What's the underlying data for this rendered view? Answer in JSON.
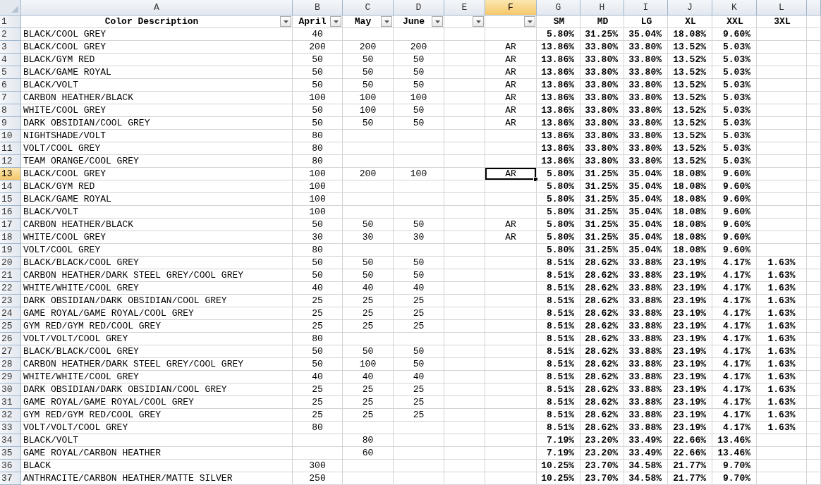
{
  "columns": [
    {
      "letter": "A",
      "selected": false
    },
    {
      "letter": "B",
      "selected": false
    },
    {
      "letter": "C",
      "selected": false
    },
    {
      "letter": "D",
      "selected": false
    },
    {
      "letter": "E",
      "selected": false
    },
    {
      "letter": "F",
      "selected": true
    },
    {
      "letter": "G",
      "selected": false
    },
    {
      "letter": "H",
      "selected": false
    },
    {
      "letter": "I",
      "selected": false
    },
    {
      "letter": "J",
      "selected": false
    },
    {
      "letter": "K",
      "selected": false
    },
    {
      "letter": "L",
      "selected": false
    }
  ],
  "header_row": {
    "number": "1",
    "selected": false,
    "cells": [
      {
        "text": "Color Description",
        "filter": true
      },
      {
        "text": "April",
        "filter": true
      },
      {
        "text": "May",
        "filter": true
      },
      {
        "text": "June",
        "filter": true
      },
      {
        "filter": true
      },
      {
        "filter": true
      },
      {
        "text": "SM",
        "filter": false
      },
      {
        "text": "MD",
        "filter": false
      },
      {
        "text": "LG",
        "filter": false
      },
      {
        "text": "XL",
        "filter": false
      },
      {
        "text": "XXL",
        "filter": false
      },
      {
        "text": "3XL",
        "filter": false
      }
    ]
  },
  "rows": [
    {
      "number": "2",
      "selected": false,
      "cells": {
        "A": "BLACK/COOL GREY",
        "B": "40",
        "G": "5.80%",
        "H": "31.25%",
        "I": "35.04%",
        "J": "18.08%",
        "K": "9.60%"
      }
    },
    {
      "number": "3",
      "selected": false,
      "cells": {
        "A": "BLACK/COOL GREY",
        "B": "200",
        "C": "200",
        "D": "200",
        "F": "AR",
        "G": "13.86%",
        "H": "33.80%",
        "I": "33.80%",
        "J": "13.52%",
        "K": "5.03%"
      }
    },
    {
      "number": "4",
      "selected": false,
      "cells": {
        "A": "BLACK/GYM RED",
        "B": "50",
        "C": "50",
        "D": "50",
        "F": "AR",
        "G": "13.86%",
        "H": "33.80%",
        "I": "33.80%",
        "J": "13.52%",
        "K": "5.03%"
      }
    },
    {
      "number": "5",
      "selected": false,
      "cells": {
        "A": "BLACK/GAME ROYAL",
        "B": "50",
        "C": "50",
        "D": "50",
        "F": "AR",
        "G": "13.86%",
        "H": "33.80%",
        "I": "33.80%",
        "J": "13.52%",
        "K": "5.03%"
      }
    },
    {
      "number": "6",
      "selected": false,
      "cells": {
        "A": "BLACK/VOLT",
        "B": "50",
        "C": "50",
        "D": "50",
        "F": "AR",
        "G": "13.86%",
        "H": "33.80%",
        "I": "33.80%",
        "J": "13.52%",
        "K": "5.03%"
      }
    },
    {
      "number": "7",
      "selected": false,
      "cells": {
        "A": "CARBON HEATHER/BLACK",
        "B": "100",
        "C": "100",
        "D": "100",
        "F": "AR",
        "G": "13.86%",
        "H": "33.80%",
        "I": "33.80%",
        "J": "13.52%",
        "K": "5.03%"
      }
    },
    {
      "number": "8",
      "selected": false,
      "cells": {
        "A": "WHITE/COOL GREY",
        "B": "50",
        "C": "100",
        "D": "50",
        "F": "AR",
        "G": "13.86%",
        "H": "33.80%",
        "I": "33.80%",
        "J": "13.52%",
        "K": "5.03%"
      }
    },
    {
      "number": "9",
      "selected": false,
      "cells": {
        "A": "DARK OBSIDIAN/COOL GREY",
        "B": "50",
        "C": "50",
        "D": "50",
        "F": "AR",
        "G": "13.86%",
        "H": "33.80%",
        "I": "33.80%",
        "J": "13.52%",
        "K": "5.03%"
      }
    },
    {
      "number": "10",
      "selected": false,
      "cells": {
        "A": "NIGHTSHADE/VOLT",
        "B": "80",
        "G": "13.86%",
        "H": "33.80%",
        "I": "33.80%",
        "J": "13.52%",
        "K": "5.03%"
      }
    },
    {
      "number": "11",
      "selected": false,
      "cells": {
        "A": "VOLT/COOL GREY",
        "B": "80",
        "G": "13.86%",
        "H": "33.80%",
        "I": "33.80%",
        "J": "13.52%",
        "K": "5.03%"
      }
    },
    {
      "number": "12",
      "selected": false,
      "cells": {
        "A": "TEAM ORANGE/COOL GREY",
        "B": "80",
        "G": "13.86%",
        "H": "33.80%",
        "I": "33.80%",
        "J": "13.52%",
        "K": "5.03%"
      }
    },
    {
      "number": "13",
      "selected": true,
      "cells": {
        "A": "BLACK/COOL GREY",
        "B": "100",
        "C": "200",
        "D": "100",
        "F": "AR",
        "G": "5.80%",
        "H": "31.25%",
        "I": "35.04%",
        "J": "18.08%",
        "K": "9.60%"
      }
    },
    {
      "number": "14",
      "selected": false,
      "cells": {
        "A": "BLACK/GYM RED",
        "B": "100",
        "G": "5.80%",
        "H": "31.25%",
        "I": "35.04%",
        "J": "18.08%",
        "K": "9.60%"
      }
    },
    {
      "number": "15",
      "selected": false,
      "cells": {
        "A": "BLACK/GAME ROYAL",
        "B": "100",
        "G": "5.80%",
        "H": "31.25%",
        "I": "35.04%",
        "J": "18.08%",
        "K": "9.60%"
      }
    },
    {
      "number": "16",
      "selected": false,
      "cells": {
        "A": "BLACK/VOLT",
        "B": "100",
        "G": "5.80%",
        "H": "31.25%",
        "I": "35.04%",
        "J": "18.08%",
        "K": "9.60%"
      }
    },
    {
      "number": "17",
      "selected": false,
      "cells": {
        "A": "CARBON HEATHER/BLACK",
        "B": "50",
        "C": "50",
        "D": "50",
        "F": "AR",
        "G": "5.80%",
        "H": "31.25%",
        "I": "35.04%",
        "J": "18.08%",
        "K": "9.60%"
      }
    },
    {
      "number": "18",
      "selected": false,
      "cells": {
        "A": "WHITE/COOL GREY",
        "B": "30",
        "C": "30",
        "D": "30",
        "F": "AR",
        "G": "5.80%",
        "H": "31.25%",
        "I": "35.04%",
        "J": "18.08%",
        "K": "9.60%"
      }
    },
    {
      "number": "19",
      "selected": false,
      "cells": {
        "A": "VOLT/COOL GREY",
        "B": "80",
        "G": "5.80%",
        "H": "31.25%",
        "I": "35.04%",
        "J": "18.08%",
        "K": "9.60%"
      }
    },
    {
      "number": "20",
      "selected": false,
      "cells": {
        "A": "BLACK/BLACK/COOL GREY",
        "B": "50",
        "C": "50",
        "D": "50",
        "G": "8.51%",
        "H": "28.62%",
        "I": "33.88%",
        "J": "23.19%",
        "K": "4.17%",
        "L": "1.63%"
      }
    },
    {
      "number": "21",
      "selected": false,
      "cells": {
        "A": "CARBON HEATHER/DARK STEEL GREY/COOL GREY",
        "B": "50",
        "C": "50",
        "D": "50",
        "G": "8.51%",
        "H": "28.62%",
        "I": "33.88%",
        "J": "23.19%",
        "K": "4.17%",
        "L": "1.63%"
      }
    },
    {
      "number": "22",
      "selected": false,
      "cells": {
        "A": "WHITE/WHITE/COOL GREY",
        "B": "40",
        "C": "40",
        "D": "40",
        "G": "8.51%",
        "H": "28.62%",
        "I": "33.88%",
        "J": "23.19%",
        "K": "4.17%",
        "L": "1.63%"
      }
    },
    {
      "number": "23",
      "selected": false,
      "cells": {
        "A": "DARK OBSIDIAN/DARK OBSIDIAN/COOL GREY",
        "B": "25",
        "C": "25",
        "D": "25",
        "G": "8.51%",
        "H": "28.62%",
        "I": "33.88%",
        "J": "23.19%",
        "K": "4.17%",
        "L": "1.63%"
      }
    },
    {
      "number": "24",
      "selected": false,
      "cells": {
        "A": "GAME ROYAL/GAME ROYAL/COOL GREY",
        "B": "25",
        "C": "25",
        "D": "25",
        "G": "8.51%",
        "H": "28.62%",
        "I": "33.88%",
        "J": "23.19%",
        "K": "4.17%",
        "L": "1.63%"
      }
    },
    {
      "number": "25",
      "selected": false,
      "cells": {
        "A": "GYM RED/GYM RED/COOL GREY",
        "B": "25",
        "C": "25",
        "D": "25",
        "G": "8.51%",
        "H": "28.62%",
        "I": "33.88%",
        "J": "23.19%",
        "K": "4.17%",
        "L": "1.63%"
      }
    },
    {
      "number": "26",
      "selected": false,
      "cells": {
        "A": "VOLT/VOLT/COOL GREY",
        "B": "80",
        "G": "8.51%",
        "H": "28.62%",
        "I": "33.88%",
        "J": "23.19%",
        "K": "4.17%",
        "L": "1.63%"
      }
    },
    {
      "number": "27",
      "selected": false,
      "cells": {
        "A": "BLACK/BLACK/COOL GREY",
        "B": "50",
        "C": "50",
        "D": "50",
        "G": "8.51%",
        "H": "28.62%",
        "I": "33.88%",
        "J": "23.19%",
        "K": "4.17%",
        "L": "1.63%"
      }
    },
    {
      "number": "28",
      "selected": false,
      "cells": {
        "A": "CARBON HEATHER/DARK STEEL GREY/COOL GREY",
        "B": "50",
        "C": "100",
        "D": "50",
        "G": "8.51%",
        "H": "28.62%",
        "I": "33.88%",
        "J": "23.19%",
        "K": "4.17%",
        "L": "1.63%"
      }
    },
    {
      "number": "29",
      "selected": false,
      "cells": {
        "A": "WHITE/WHITE/COOL GREY",
        "B": "40",
        "C": "40",
        "D": "40",
        "G": "8.51%",
        "H": "28.62%",
        "I": "33.88%",
        "J": "23.19%",
        "K": "4.17%",
        "L": "1.63%"
      }
    },
    {
      "number": "30",
      "selected": false,
      "cells": {
        "A": "DARK OBSIDIAN/DARK OBSIDIAN/COOL GREY",
        "B": "25",
        "C": "25",
        "D": "25",
        "G": "8.51%",
        "H": "28.62%",
        "I": "33.88%",
        "J": "23.19%",
        "K": "4.17%",
        "L": "1.63%"
      }
    },
    {
      "number": "31",
      "selected": false,
      "cells": {
        "A": "GAME ROYAL/GAME ROYAL/COOL GREY",
        "B": "25",
        "C": "25",
        "D": "25",
        "G": "8.51%",
        "H": "28.62%",
        "I": "33.88%",
        "J": "23.19%",
        "K": "4.17%",
        "L": "1.63%"
      }
    },
    {
      "number": "32",
      "selected": false,
      "cells": {
        "A": "GYM RED/GYM RED/COOL GREY",
        "B": "25",
        "C": "25",
        "D": "25",
        "G": "8.51%",
        "H": "28.62%",
        "I": "33.88%",
        "J": "23.19%",
        "K": "4.17%",
        "L": "1.63%"
      }
    },
    {
      "number": "33",
      "selected": false,
      "cells": {
        "A": "VOLT/VOLT/COOL GREY",
        "B": "80",
        "G": "8.51%",
        "H": "28.62%",
        "I": "33.88%",
        "J": "23.19%",
        "K": "4.17%",
        "L": "1.63%"
      }
    },
    {
      "number": "34",
      "selected": false,
      "cells": {
        "A": "BLACK/VOLT",
        "C": "80",
        "G": "7.19%",
        "H": "23.20%",
        "I": "33.49%",
        "J": "22.66%",
        "K": "13.46%"
      }
    },
    {
      "number": "35",
      "selected": false,
      "cells": {
        "A": "GAME ROYAL/CARBON HEATHER",
        "C": "60",
        "G": "7.19%",
        "H": "23.20%",
        "I": "33.49%",
        "J": "22.66%",
        "K": "13.46%"
      }
    },
    {
      "number": "36",
      "selected": false,
      "cells": {
        "A": "BLACK",
        "B": "300",
        "G": "10.25%",
        "H": "23.70%",
        "I": "34.58%",
        "J": "21.77%",
        "K": "9.70%"
      }
    },
    {
      "number": "37",
      "selected": false,
      "cells": {
        "A": "ANTHRACITE/CARBON HEATHER/MATTE SILVER",
        "B": "250",
        "G": "10.25%",
        "H": "23.70%",
        "I": "34.58%",
        "J": "21.77%",
        "K": "9.70%"
      }
    }
  ]
}
